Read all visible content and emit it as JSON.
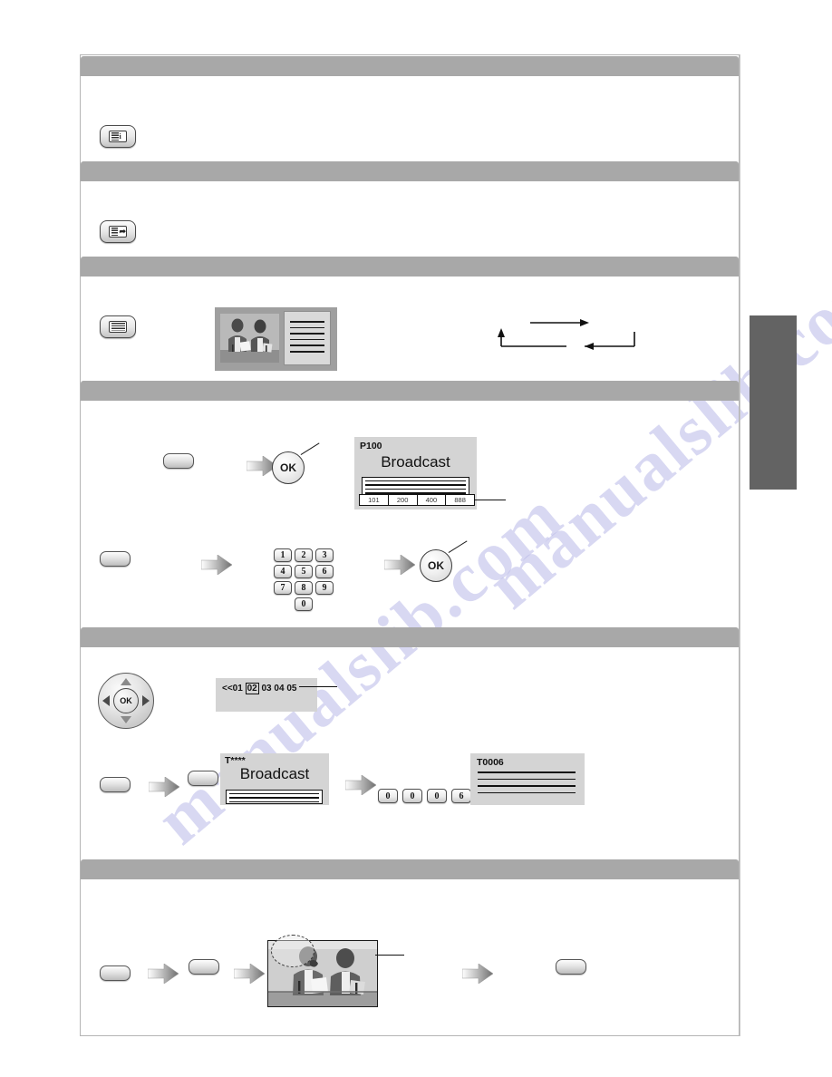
{
  "page": {
    "watermark_text": "manualslib.com",
    "watermark_text_2": "manualslib.com"
  },
  "sections": [
    {
      "id": "sec-1",
      "label": ""
    },
    {
      "id": "sec-2",
      "label": ""
    },
    {
      "id": "sec-3",
      "label": ""
    },
    {
      "id": "sec-4",
      "label": ""
    },
    {
      "id": "sec-5",
      "label": ""
    },
    {
      "id": "sec-6",
      "label": ""
    }
  ],
  "remote_keys": {
    "index_key": {
      "icon": "teletext-index-icon",
      "label": ""
    },
    "subpage_key": {
      "icon": "teletext-subpage-icon",
      "label": ""
    },
    "text_key": {
      "icon": "teletext-text-icon",
      "label": ""
    },
    "blank_key": {
      "label": ""
    },
    "ok_label": "OK"
  },
  "osd_page": {
    "page_code": "P100",
    "title": "Broadcast",
    "colour_bar": [
      "101",
      "200",
      "400",
      "888"
    ]
  },
  "osd_subpage": {
    "list": [
      "<<01",
      "02",
      "03",
      "04",
      "05"
    ],
    "selected": "02"
  },
  "osd_time": {
    "page_code": "T****",
    "title": "Broadcast"
  },
  "osd_time_entered": {
    "page_code": "T0006"
  },
  "numpad": {
    "rows": [
      [
        "1",
        "2",
        "3"
      ],
      [
        "4",
        "5",
        "6"
      ],
      [
        "7",
        "8",
        "9"
      ]
    ],
    "zero": "0"
  },
  "time_code_keys": [
    "0",
    "0",
    "0",
    "6"
  ],
  "chart_data": {
    "type": "table",
    "title": "",
    "categories": [],
    "values": []
  }
}
